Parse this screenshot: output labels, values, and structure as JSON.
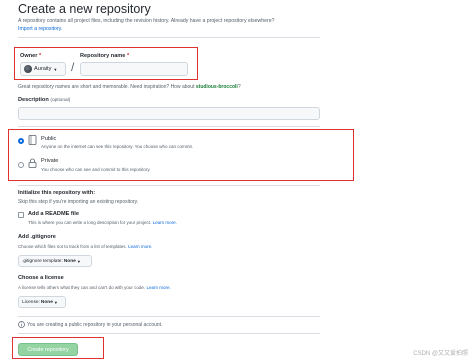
{
  "header": {
    "title": "Create a new repository",
    "subtitle": "A repository contains all project files, including the revision history. Already have a project repository elsewhere?",
    "import_link": "Import a repository."
  },
  "owner": {
    "label": "Owner",
    "required_mark": "*",
    "value": "Auraity"
  },
  "repo_name": {
    "label": "Repository name",
    "required_mark": "*",
    "value": ""
  },
  "separator": "/",
  "name_hint": {
    "prefix": "Great repository names are short and memorable. Need inspiration? How about",
    "suggestion": "studious-broccoli",
    "suffix": "?"
  },
  "description": {
    "label": "Description",
    "optional": "(optional)",
    "value": ""
  },
  "visibility": {
    "public": {
      "label": "Public",
      "desc": "Anyone on the internet can see this repository. You choose who can commit.",
      "selected": true
    },
    "private": {
      "label": "Private",
      "desc": "You choose who can see and commit to this repository.",
      "selected": false
    }
  },
  "init": {
    "title": "Initialize this repository with:",
    "subtitle": "Skip this step if you're importing an existing repository.",
    "readme_label": "Add a README file",
    "readme_desc_prefix": "This is where you can write a long description for your project.",
    "learn_more": "Learn more."
  },
  "gitignore": {
    "title": "Add .gitignore",
    "desc": "Choose which files not to track from a list of templates.",
    "learn_more": "Learn more.",
    "select_label": ".gitignore template:",
    "select_value": "None"
  },
  "license": {
    "title": "Choose a license",
    "desc": "A license tells others what they can and can't do with your code.",
    "learn_more": "Learn more.",
    "select_label": "License:",
    "select_value": "None"
  },
  "notice": "You are creating a public repository in your personal account.",
  "create_button": "Create repository",
  "watermark": "CSDN @又又爱拍照",
  "colors": {
    "accent": "#0969da",
    "highlight": "#e03131",
    "button": "#94d3a2"
  }
}
